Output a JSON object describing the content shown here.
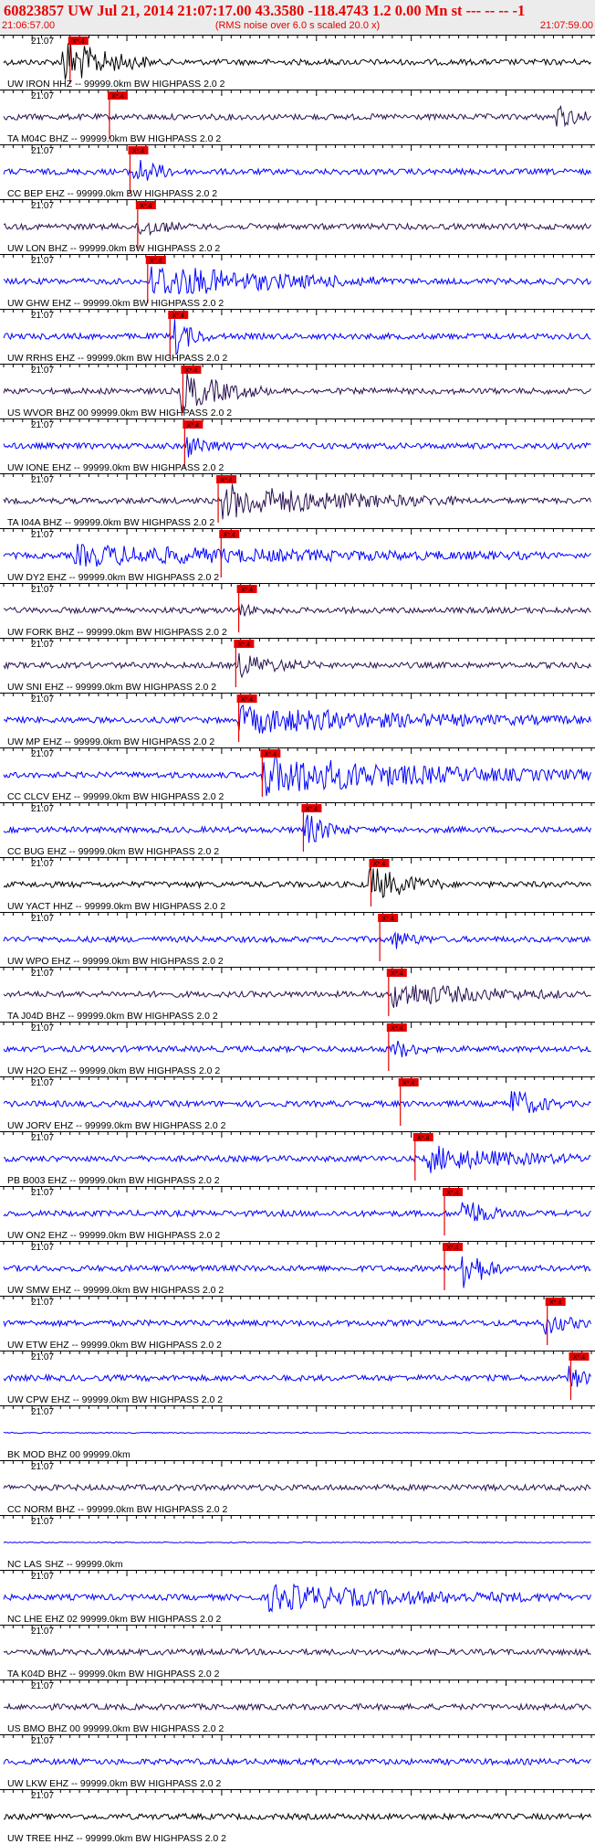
{
  "header": {
    "title": "60823857 UW Jul 21, 2014 21:07:17.00   43.3580 -118.4743  1.2 0.00 Mn st --- -- --  -1",
    "start_time": "21:06:57.00",
    "rms_note": "(RMS noise over 6.0 s scaled 20.0 x)",
    "end_time": "21:07:59.00"
  },
  "tick_minute": "21:07",
  "pick_label": "X*.4",
  "colors": {
    "black": "#000000",
    "purple": "#2a1250",
    "blue": "#0000ff",
    "pick_red": "#e60000",
    "header_bg": "#ececec"
  },
  "traces": [
    {
      "label": "UW IRON HHZ -- 99999.0km BW  HIGHPASS  2.0  2",
      "color": "black",
      "pick": 0.113,
      "burst": [
        0.1,
        0.2,
        3.2
      ]
    },
    {
      "label": "TA M04C BHZ -- 99999.0km BW  HIGHPASS  2.0  2",
      "color": "purple",
      "pick": 0.18,
      "burst": [
        0.94,
        0.97,
        1.4
      ]
    },
    {
      "label": "CC BEP EHZ -- 99999.0km BW  HIGHPASS  2.0  2",
      "color": "blue",
      "pick": 0.215,
      "burst": [
        0.22,
        0.25,
        2.0
      ]
    },
    {
      "label": "UW LON BHZ -- 99999.0km BW  HIGHPASS  2.0  2",
      "color": "purple",
      "pick": 0.228,
      "burst": [
        0.23,
        0.25,
        1.6
      ]
    },
    {
      "label": "UW GHW EHZ -- 99999.0km BW  HIGHPASS  2.0  2",
      "color": "blue",
      "pick": 0.245,
      "burst": [
        0.25,
        0.6,
        2.2
      ]
    },
    {
      "label": "UW RRHS EHZ -- 99999.0km BW  HIGHPASS  2.0  2",
      "color": "blue",
      "pick": 0.283,
      "burst": [
        0.29,
        0.3,
        2.5
      ]
    },
    {
      "label": "US WVOR BHZ 00 99999.0km BW  HIGHPASS  2.0  2",
      "color": "purple",
      "pick": 0.305,
      "burst": [
        0.3,
        0.4,
        2.6
      ]
    },
    {
      "label": "UW IONE EHZ -- 99999.0km BW  HIGHPASS  2.0  2",
      "color": "blue",
      "pick": 0.308,
      "burst": [
        0.31,
        0.34,
        1.4
      ]
    },
    {
      "label": "TA I04A BHZ -- 99999.0km BW  HIGHPASS  2.0  2",
      "color": "purple",
      "pick": 0.365,
      "burst": [
        0.37,
        0.72,
        2.2
      ]
    },
    {
      "label": "UW DY2 EHZ -- 99999.0km BW  HIGHPASS  2.0  2",
      "color": "blue",
      "pick": 0.37,
      "burst": [
        0.12,
        0.87,
        1.2
      ]
    },
    {
      "label": "UW FORK BHZ -- 99999.0km BW  HIGHPASS  2.0  2",
      "color": "purple",
      "pick": 0.4,
      "burst": [
        0.4,
        0.42,
        0.6
      ]
    },
    {
      "label": "UW SNI EHZ -- 99999.0km BW  HIGHPASS  2.0  2",
      "color": "purple",
      "pick": 0.395,
      "burst": [
        0.4,
        0.48,
        1.4
      ]
    },
    {
      "label": "UW MP EHZ -- 99999.0km BW  HIGHPASS  2.0  2",
      "color": "blue",
      "pick": 0.4,
      "burst": [
        0.4,
        0.95,
        1.6
      ]
    },
    {
      "label": "CC CLCV EHZ -- 99999.0km BW  HIGHPASS  2.0  2",
      "color": "blue",
      "pick": 0.44,
      "burst": [
        0.44,
        0.95,
        2.6
      ]
    },
    {
      "label": "CC BUG EHZ -- 99999.0km BW  HIGHPASS  2.0  2",
      "color": "blue",
      "pick": 0.51,
      "burst": [
        0.51,
        0.54,
        2.2
      ]
    },
    {
      "label": "UW YACT HHZ -- 99999.0km BW  HIGHPASS  2.0  2",
      "color": "black",
      "pick": 0.625,
      "burst": [
        0.62,
        0.7,
        2.4
      ]
    },
    {
      "label": "UW WPO EHZ -- 99999.0km BW  HIGHPASS  2.0  2",
      "color": "blue",
      "pick": 0.64,
      "burst": [
        0.66,
        0.68,
        1.2
      ]
    },
    {
      "label": "TA J04D BHZ -- 99999.0km BW  HIGHPASS  2.0  2",
      "color": "purple",
      "pick": 0.655,
      "burst": [
        0.66,
        0.9,
        1.6
      ]
    },
    {
      "label": "UW H2O EHZ -- 99999.0km BW  HIGHPASS  2.0  2",
      "color": "blue",
      "pick": 0.655,
      "burst": [
        0.66,
        0.68,
        1.3
      ]
    },
    {
      "label": "UW JORV EHZ -- 99999.0km BW  HIGHPASS  2.0  2",
      "color": "blue",
      "pick": 0.675,
      "burst": [
        0.86,
        0.9,
        2.2
      ]
    },
    {
      "label": "PB B003 EHZ -- 99999.0km BW  HIGHPASS  2.0  2",
      "color": "blue",
      "pick": 0.7,
      "burst": [
        0.72,
        0.95,
        1.6
      ]
    },
    {
      "label": "UW ON2 EHZ -- 99999.0km BW  HIGHPASS  2.0  2",
      "color": "blue",
      "pick": 0.75,
      "burst": [
        0.78,
        0.8,
        2.4
      ]
    },
    {
      "label": "UW SMW EHZ -- 99999.0km BW  HIGHPASS  2.0  2",
      "color": "blue",
      "pick": 0.75,
      "burst": [
        0.78,
        0.8,
        3.4
      ]
    },
    {
      "label": "UW ETW EHZ -- 99999.0km BW  HIGHPASS  2.0  2",
      "color": "blue",
      "pick": 0.925,
      "burst": [
        0.92,
        0.95,
        1.4
      ]
    },
    {
      "label": "UW CPW EHZ -- 99999.0km BW  HIGHPASS  2.0  2",
      "color": "blue",
      "pick": 0.965,
      "burst": [
        0.96,
        0.99,
        1.4
      ]
    },
    {
      "label": "BK MOD BHZ 00 99999.0km",
      "color": "blue",
      "pick": null,
      "flat": true
    },
    {
      "label": "CC NORM BHZ -- 99999.0km BW  HIGHPASS  2.0  2",
      "color": "purple",
      "pick": null
    },
    {
      "label": "NC LAS SHZ -- 99999.0km",
      "color": "blue",
      "pick": null,
      "flat": true
    },
    {
      "label": "NC LHE EHZ 02 99999.0km BW  HIGHPASS  2.0  2",
      "color": "blue",
      "pick": null,
      "burst": [
        0.45,
        0.9,
        1.6
      ]
    },
    {
      "label": "TA K04D BHZ -- 99999.0km BW  HIGHPASS  2.0  2",
      "color": "purple",
      "pick": null
    },
    {
      "label": "US BMO BHZ 00 99999.0km BW  HIGHPASS  2.0  2",
      "color": "purple",
      "pick": null
    },
    {
      "label": "UW LKW EHZ -- 99999.0km BW  HIGHPASS  2.0  2",
      "color": "blue",
      "pick": null
    },
    {
      "label": "UW TREE HHZ -- 99999.0km BW  HIGHPASS  2.0  2",
      "color": "black",
      "pick": null
    }
  ]
}
